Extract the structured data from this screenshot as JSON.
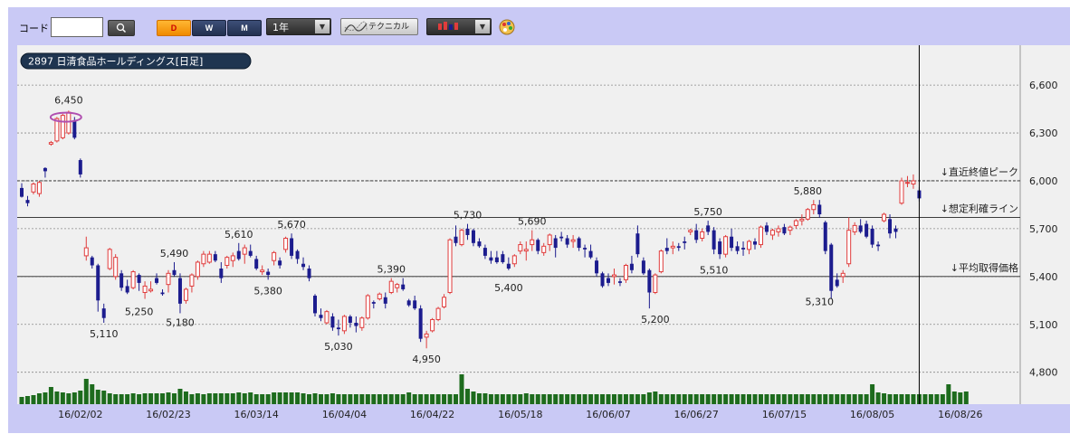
{
  "toolbar": {
    "code_label": "コード",
    "code_value": "",
    "period_buttons": [
      "D",
      "W",
      "M"
    ],
    "range_value": "1年",
    "technical_label": "テクニカル"
  },
  "chart_title": "2897 日清食品ホールディングス[日足]",
  "chart_data": {
    "type": "candlestick",
    "title": "2897 日清食品ホールディングス[日足]",
    "ylim": [
      4600,
      6850
    ],
    "y_ticks": [
      4800,
      5100,
      5400,
      5700,
      6000,
      6300,
      6600
    ],
    "y_tick_labels": [
      "4,800",
      "5,100",
      "5,400",
      "5,700",
      "6,000",
      "6,300",
      "6,600"
    ],
    "x_tick_labels": [
      "16/02/02",
      "16/02/23",
      "16/03/14",
      "16/04/04",
      "16/04/22",
      "16/05/18",
      "16/06/07",
      "16/06/27",
      "16/07/15",
      "16/08/05",
      "16/08/26"
    ],
    "x_tick_index": [
      10,
      25,
      40,
      55,
      70,
      85,
      100,
      115,
      130,
      145,
      160
    ],
    "grid": true,
    "candles": [
      [
        5955,
        5985,
        5895,
        5900
      ],
      [
        5880,
        5905,
        5840,
        5860
      ],
      [
        5930,
        5990,
        5915,
        5980
      ],
      [
        5920,
        6000,
        5900,
        5990
      ],
      [
        6080,
        6085,
        6020,
        6060
      ],
      [
        6230,
        6250,
        6220,
        6240
      ],
      [
        6250,
        6400,
        6240,
        6390
      ],
      [
        6270,
        6420,
        6260,
        6410
      ],
      [
        6300,
        6440,
        6290,
        6430
      ],
      [
        6380,
        6400,
        6260,
        6270
      ],
      [
        6130,
        6140,
        6020,
        6040
      ],
      [
        5530,
        5650,
        5500,
        5580
      ],
      [
        5520,
        5530,
        5450,
        5470
      ],
      [
        5470,
        5480,
        5180,
        5250
      ],
      [
        5200,
        5230,
        5110,
        5140
      ],
      [
        5450,
        5580,
        5440,
        5570
      ],
      [
        5400,
        5540,
        5380,
        5520
      ],
      [
        5420,
        5440,
        5310,
        5330
      ],
      [
        5340,
        5380,
        5290,
        5300
      ],
      [
        5330,
        5440,
        5320,
        5430
      ],
      [
        5410,
        5420,
        5310,
        5360
      ],
      [
        5300,
        5370,
        5260,
        5340
      ],
      [
        5310,
        5370,
        5300,
        5320
      ],
      [
        5390,
        5420,
        5350,
        5360
      ],
      [
        5300,
        5320,
        5280,
        5290
      ],
      [
        5350,
        5440,
        5300,
        5420
      ],
      [
        5440,
        5490,
        5400,
        5410
      ],
      [
        5390,
        5420,
        5170,
        5230
      ],
      [
        5250,
        5330,
        5230,
        5320
      ],
      [
        5340,
        5420,
        5300,
        5410
      ],
      [
        5400,
        5500,
        5380,
        5490
      ],
      [
        5480,
        5560,
        5460,
        5540
      ],
      [
        5490,
        5560,
        5480,
        5540
      ],
      [
        5540,
        5560,
        5490,
        5500
      ],
      [
        5450,
        5490,
        5360,
        5390
      ],
      [
        5470,
        5530,
        5450,
        5520
      ],
      [
        5500,
        5550,
        5460,
        5530
      ],
      [
        5560,
        5610,
        5500,
        5510
      ],
      [
        5540,
        5600,
        5480,
        5580
      ],
      [
        5560,
        5600,
        5520,
        5530
      ],
      [
        5510,
        5530,
        5440,
        5450
      ],
      [
        5430,
        5470,
        5410,
        5440
      ],
      [
        5430,
        5450,
        5380,
        5410
      ],
      [
        5500,
        5560,
        5470,
        5550
      ],
      [
        5500,
        5520,
        5450,
        5470
      ],
      [
        5570,
        5650,
        5550,
        5640
      ],
      [
        5640,
        5670,
        5510,
        5530
      ],
      [
        5560,
        5570,
        5480,
        5510
      ],
      [
        5480,
        5520,
        5440,
        5460
      ],
      [
        5450,
        5470,
        5370,
        5390
      ],
      [
        5280,
        5290,
        5150,
        5170
      ],
      [
        5160,
        5200,
        5120,
        5140
      ],
      [
        5110,
        5190,
        5100,
        5180
      ],
      [
        5150,
        5170,
        5060,
        5080
      ],
      [
        5080,
        5130,
        5030,
        5070
      ],
      [
        5060,
        5160,
        5040,
        5150
      ],
      [
        5150,
        5160,
        5080,
        5110
      ],
      [
        5110,
        5150,
        5050,
        5090
      ],
      [
        5080,
        5150,
        5060,
        5140
      ],
      [
        5140,
        5290,
        5130,
        5280
      ],
      [
        5240,
        5250,
        5200,
        5230
      ],
      [
        5260,
        5300,
        5250,
        5290
      ],
      [
        5270,
        5300,
        5200,
        5230
      ],
      [
        5300,
        5390,
        5290,
        5370
      ],
      [
        5330,
        5360,
        5300,
        5350
      ],
      [
        5350,
        5390,
        5310,
        5320
      ],
      [
        5250,
        5260,
        5210,
        5220
      ],
      [
        5250,
        5280,
        5190,
        5200
      ],
      [
        5200,
        5220,
        4990,
        5010
      ],
      [
        5020,
        5060,
        4950,
        5040
      ],
      [
        5060,
        5140,
        5050,
        5130
      ],
      [
        5130,
        5210,
        5120,
        5200
      ],
      [
        5210,
        5290,
        5200,
        5270
      ],
      [
        5300,
        5640,
        5290,
        5630
      ],
      [
        5650,
        5720,
        5590,
        5610
      ],
      [
        5600,
        5700,
        5590,
        5690
      ],
      [
        5700,
        5730,
        5630,
        5660
      ],
      [
        5690,
        5700,
        5590,
        5610
      ],
      [
        5620,
        5640,
        5580,
        5590
      ],
      [
        5580,
        5600,
        5510,
        5530
      ],
      [
        5520,
        5560,
        5480,
        5500
      ],
      [
        5520,
        5560,
        5480,
        5490
      ],
      [
        5540,
        5560,
        5480,
        5490
      ],
      [
        5480,
        5520,
        5440,
        5450
      ],
      [
        5480,
        5540,
        5460,
        5530
      ],
      [
        5560,
        5620,
        5540,
        5600
      ],
      [
        5560,
        5620,
        5500,
        5570
      ],
      [
        5600,
        5690,
        5560,
        5630
      ],
      [
        5630,
        5640,
        5540,
        5560
      ],
      [
        5550,
        5610,
        5530,
        5590
      ],
      [
        5600,
        5670,
        5560,
        5660
      ],
      [
        5640,
        5660,
        5520,
        5580
      ],
      [
        5650,
        5680,
        5620,
        5640
      ],
      [
        5640,
        5660,
        5580,
        5600
      ],
      [
        5620,
        5660,
        5580,
        5630
      ],
      [
        5640,
        5650,
        5560,
        5580
      ],
      [
        5580,
        5600,
        5520,
        5570
      ],
      [
        5560,
        5600,
        5510,
        5520
      ],
      [
        5500,
        5520,
        5400,
        5420
      ],
      [
        5420,
        5430,
        5330,
        5340
      ],
      [
        5390,
        5420,
        5340,
        5360
      ],
      [
        5400,
        5450,
        5350,
        5410
      ],
      [
        5370,
        5390,
        5340,
        5360
      ],
      [
        5380,
        5480,
        5360,
        5470
      ],
      [
        5480,
        5530,
        5420,
        5440
      ],
      [
        5670,
        5720,
        5520,
        5540
      ],
      [
        5500,
        5520,
        5410,
        5420
      ],
      [
        5440,
        5450,
        5200,
        5300
      ],
      [
        5300,
        5420,
        5290,
        5410
      ],
      [
        5430,
        5570,
        5420,
        5560
      ],
      [
        5580,
        5640,
        5540,
        5560
      ],
      [
        5580,
        5620,
        5540,
        5590
      ],
      [
        5590,
        5610,
        5560,
        5580
      ],
      [
        5620,
        5650,
        5570,
        5610
      ],
      [
        5680,
        5700,
        5660,
        5690
      ],
      [
        5690,
        5730,
        5610,
        5630
      ],
      [
        5640,
        5700,
        5620,
        5680
      ],
      [
        5720,
        5750,
        5660,
        5680
      ],
      [
        5690,
        5710,
        5540,
        5570
      ],
      [
        5620,
        5640,
        5510,
        5540
      ],
      [
        5540,
        5660,
        5520,
        5650
      ],
      [
        5650,
        5700,
        5560,
        5580
      ],
      [
        5590,
        5620,
        5540,
        5560
      ],
      [
        5580,
        5620,
        5530,
        5570
      ],
      [
        5570,
        5630,
        5540,
        5620
      ],
      [
        5620,
        5640,
        5570,
        5600
      ],
      [
        5600,
        5720,
        5580,
        5710
      ],
      [
        5720,
        5740,
        5660,
        5680
      ],
      [
        5660,
        5700,
        5630,
        5690
      ],
      [
        5680,
        5720,
        5650,
        5700
      ],
      [
        5710,
        5730,
        5660,
        5670
      ],
      [
        5690,
        5720,
        5660,
        5710
      ],
      [
        5720,
        5760,
        5700,
        5750
      ],
      [
        5750,
        5790,
        5720,
        5760
      ],
      [
        5760,
        5830,
        5750,
        5820
      ],
      [
        5820,
        5880,
        5790,
        5850
      ],
      [
        5850,
        5880,
        5770,
        5790
      ],
      [
        5740,
        5750,
        5540,
        5560
      ],
      [
        5600,
        5610,
        5260,
        5310
      ],
      [
        5380,
        5420,
        5330,
        5340
      ],
      [
        5400,
        5440,
        5360,
        5420
      ],
      [
        5480,
        5770,
        5460,
        5690
      ],
      [
        5680,
        5740,
        5660,
        5720
      ],
      [
        5720,
        5760,
        5670,
        5680
      ],
      [
        5730,
        5750,
        5640,
        5650
      ],
      [
        5700,
        5720,
        5580,
        5600
      ],
      [
        5600,
        5620,
        5560,
        5590
      ],
      [
        5750,
        5800,
        5740,
        5790
      ],
      [
        5760,
        5790,
        5640,
        5670
      ],
      [
        5700,
        5720,
        5640,
        5680
      ],
      [
        5860,
        6020,
        5850,
        6000
      ],
      [
        5990,
        6030,
        5960,
        5990
      ],
      [
        5980,
        6040,
        5950,
        6000
      ],
      [
        5940,
        5960,
        5870,
        5890
      ]
    ],
    "volumes": [
      8,
      9,
      10,
      12,
      13,
      19,
      14,
      13,
      12,
      13,
      15,
      28,
      22,
      16,
      15,
      12,
      11,
      11,
      11,
      12,
      11,
      12,
      12,
      12,
      12,
      13,
      12,
      17,
      14,
      11,
      12,
      11,
      12,
      12,
      12,
      12,
      12,
      13,
      12,
      13,
      11,
      11,
      11,
      13,
      13,
      13,
      13,
      13,
      12,
      11,
      12,
      11,
      11,
      12,
      11,
      11,
      11,
      11,
      11,
      11,
      11,
      11,
      11,
      11,
      11,
      11,
      13,
      11,
      11,
      11,
      11,
      11,
      11,
      11,
      11,
      33,
      17,
      14,
      12,
      12,
      11,
      11,
      11,
      11,
      11,
      11,
      12,
      11,
      11,
      11,
      11,
      11,
      11,
      11,
      11,
      11,
      11,
      11,
      11,
      11,
      11,
      11,
      11,
      11,
      11,
      11,
      11,
      13,
      14,
      11,
      11,
      11,
      11,
      11,
      11,
      11,
      11,
      11,
      11,
      11,
      11,
      11,
      11,
      11,
      11,
      11,
      11,
      11,
      11,
      11,
      11,
      11,
      11,
      11,
      11,
      11,
      11,
      11,
      11,
      11,
      11,
      11,
      11,
      11,
      11,
      22,
      13,
      12,
      11,
      11,
      11,
      11,
      11,
      11,
      11,
      11,
      11,
      11,
      22,
      14,
      13,
      14
    ],
    "annotations": [
      {
        "label": "6,450",
        "index": 8,
        "price": 6450,
        "pos": "above"
      },
      {
        "label": "5,110",
        "index": 14,
        "price": 5110,
        "pos": "below"
      },
      {
        "label": "5,250",
        "index": 20,
        "price": 5250,
        "pos": "below"
      },
      {
        "label": "5,490",
        "index": 26,
        "price": 5490,
        "pos": "above"
      },
      {
        "label": "5,180",
        "index": 27,
        "price": 5180,
        "pos": "below"
      },
      {
        "label": "5,610",
        "index": 37,
        "price": 5610,
        "pos": "above"
      },
      {
        "label": "5,380",
        "index": 42,
        "price": 5380,
        "pos": "below"
      },
      {
        "label": "5,670",
        "index": 46,
        "price": 5670,
        "pos": "above"
      },
      {
        "label": "5,030",
        "index": 54,
        "price": 5030,
        "pos": "below"
      },
      {
        "label": "5,390",
        "index": 63,
        "price": 5390,
        "pos": "above"
      },
      {
        "label": "4,950",
        "index": 69,
        "price": 4950,
        "pos": "below"
      },
      {
        "label": "5,730",
        "index": 76,
        "price": 5730,
        "pos": "above"
      },
      {
        "label": "5,400",
        "index": 83,
        "price": 5400,
        "pos": "below"
      },
      {
        "label": "5,690",
        "index": 87,
        "price": 5690,
        "pos": "above"
      },
      {
        "label": "5,200",
        "index": 108,
        "price": 5200,
        "pos": "below"
      },
      {
        "label": "5,750",
        "index": 117,
        "price": 5750,
        "pos": "above"
      },
      {
        "label": "5,510",
        "index": 118,
        "price": 5510,
        "pos": "below"
      },
      {
        "label": "5,880",
        "index": 134,
        "price": 5880,
        "pos": "above"
      },
      {
        "label": "5,310",
        "index": 136,
        "price": 5310,
        "pos": "below"
      }
    ],
    "reference_lines": [
      {
        "label": "↓直近終値ピーク",
        "price": 6000,
        "style": "dashed"
      },
      {
        "label": "↓想定利確ライン",
        "price": 5770,
        "style": "solid"
      },
      {
        "label": "↓平均取得価格",
        "price": 5400,
        "style": "solid"
      }
    ],
    "cursor_index": 153,
    "colors": {
      "up": "#e03c3c",
      "down": "#1c1c8e",
      "volume": "#1d6b1d",
      "grid": "#888888",
      "ellipse": "#b04fb0"
    }
  }
}
